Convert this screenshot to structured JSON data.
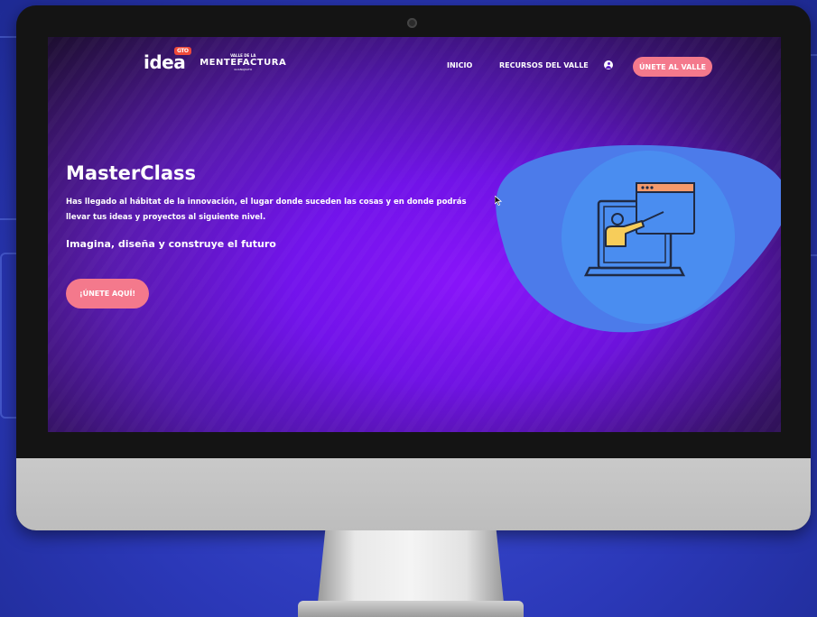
{
  "nav": {
    "logo_idea": "idea",
    "logo_gto": "GTO",
    "logo_valle_top": "VALLE DE LA",
    "logo_valle_main": "MENTEFACTURA",
    "logo_valle_sub": "GUANAJUATO",
    "links": [
      "INICIO",
      "RECURSOS DEL VALLE"
    ],
    "join_label": "ÚNETE AL VALLE"
  },
  "hero": {
    "title": "MasterClass",
    "description": "Has llegado al hábitat de la innovación, el lugar donde suceden las cosas y en donde podrás llevar tus ideas y proyectos al siguiente nivel.",
    "subtitle": "Imagina, diseña y construye el futuro",
    "cta_label": "¡ÚNETE AQUÍ!"
  },
  "colors": {
    "accent_button": "#f4798c",
    "blob": "#4c7bea",
    "circle": "#4a8df0",
    "logo_badge": "#ef4a3a"
  },
  "icons": {
    "user": "user-circle-icon",
    "illustration": "online-teacher-icon"
  }
}
